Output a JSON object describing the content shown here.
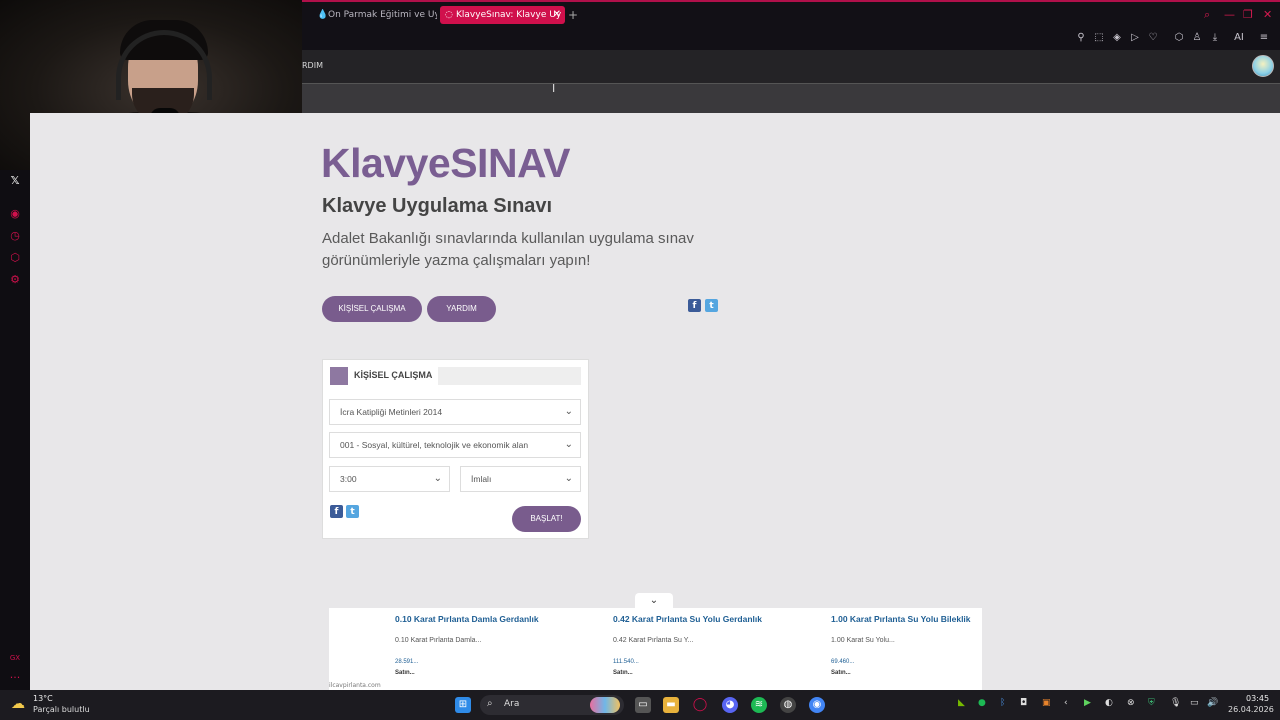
{
  "browser": {
    "tabs": [
      {
        "label": "On Parmak Eğitimi ve Uyg",
        "active": false
      },
      {
        "label": "KlavyeSınav: Klavye Uy",
        "active": true
      }
    ],
    "new_tab_symbol": "+",
    "tab_close_symbol": "✕",
    "accent_color": "#d0104c",
    "toolbar_ai_label": "AI"
  },
  "site": {
    "nav_label": "RDIM",
    "title": "KlavyeSINAV",
    "subtitle": "Klavye Uygulama Sınavı",
    "description": "Adalet Bakanlığı sınavlarında kullanılan uygulama sınav görünümleriyle yazma çalışmaları yapın!",
    "buttons": {
      "personal": "KİŞİSEL ÇALIŞMA",
      "help": "YARDIM"
    },
    "brand_color": "#7a5e92"
  },
  "card": {
    "title": "KİŞİSEL ÇALIŞMA",
    "text_select": "İcra Katipliği Metinleri 2014",
    "topic_select": "001 - Sosyal, kültürel, teknolojik ve ekonomik alan",
    "time_select": "3:00",
    "mode_select": "İmlalı",
    "start_button": "BAŞLAT!"
  },
  "ad": {
    "items": [
      {
        "title": "0.10 Karat Pırlanta Damla Gerdanlık",
        "desc": "0.10 Karat Pırlanta Damla...",
        "price": "28.591...",
        "buy": "Satın..."
      },
      {
        "title": "0.42 Karat Pırlanta Su Yolu Gerdanlık",
        "desc": "0.42 Karat Pırlanta Su Y...",
        "price": "111.540...",
        "buy": "Satın..."
      },
      {
        "title": "1.00 Karat Pırlanta Su Yolu Bileklik",
        "desc": "1.00 Karat Su Yolu...",
        "price": "69.460...",
        "buy": "Satın..."
      }
    ],
    "domain": "ilcavpirlanta.com"
  },
  "sidebar": {
    "x_label": "𝕏",
    "gx_label": "GX",
    "more_label": "···"
  },
  "taskbar": {
    "weather_temp": "13°C",
    "weather_desc": "Parçalı bulutlu",
    "search_label": "Ara",
    "time": "03:45",
    "date": "26.04.2026"
  }
}
